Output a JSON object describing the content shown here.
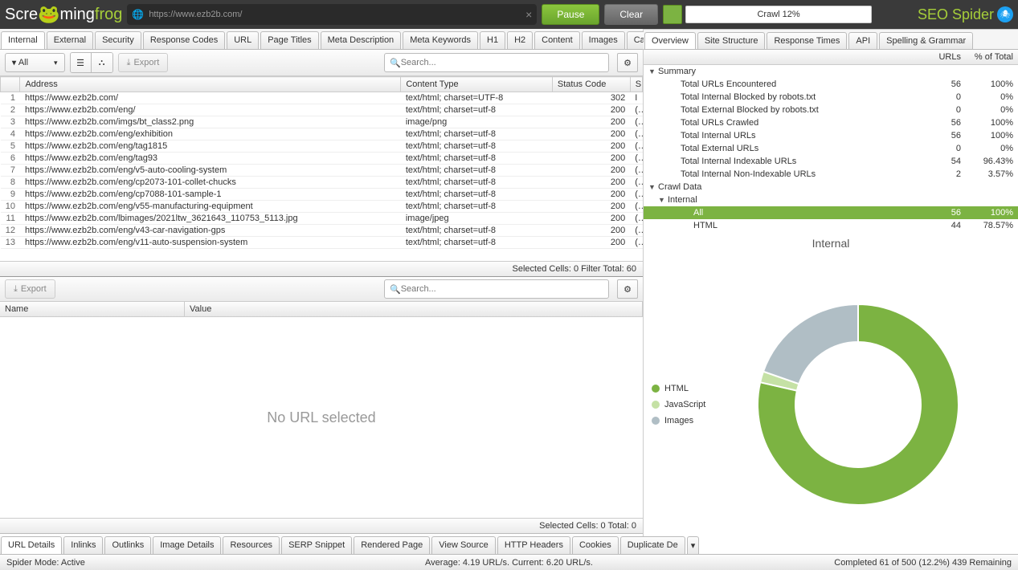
{
  "header": {
    "logo_plain1": "Scre",
    "logo_plain2": "ming",
    "logo_accent": "frog",
    "url": "https://www.ezb2b.com/",
    "pause": "Pause",
    "clear": "Clear",
    "progress_text": "Crawl 12%",
    "seo_spider": "SEO Spider"
  },
  "main_tabs": [
    "Internal",
    "External",
    "Security",
    "Response Codes",
    "URL",
    "Page Titles",
    "Meta Description",
    "Meta Keywords",
    "H1",
    "H2",
    "Content",
    "Images",
    "Canonicals"
  ],
  "toolbar": {
    "filter_all": "All",
    "export": "Export",
    "search_placeholder": "Search..."
  },
  "columns": {
    "address": "Address",
    "content_type": "Content Type",
    "status_code": "Status Code",
    "s": "S"
  },
  "rows": [
    {
      "n": 1,
      "address": "https://www.ezb2b.com/",
      "ct": "text/html; charset=UTF-8",
      "sc": "302",
      "s": "I"
    },
    {
      "n": 2,
      "address": "https://www.ezb2b.com/eng/",
      "ct": "text/html; charset=utf-8",
      "sc": "200",
      "s": "("
    },
    {
      "n": 3,
      "address": "https://www.ezb2b.com/imgs/bt_class2.png",
      "ct": "image/png",
      "sc": "200",
      "s": "("
    },
    {
      "n": 4,
      "address": "https://www.ezb2b.com/eng/exhibition",
      "ct": "text/html; charset=utf-8",
      "sc": "200",
      "s": "("
    },
    {
      "n": 5,
      "address": "https://www.ezb2b.com/eng/tag1815",
      "ct": "text/html; charset=utf-8",
      "sc": "200",
      "s": "("
    },
    {
      "n": 6,
      "address": "https://www.ezb2b.com/eng/tag93",
      "ct": "text/html; charset=utf-8",
      "sc": "200",
      "s": "("
    },
    {
      "n": 7,
      "address": "https://www.ezb2b.com/eng/v5-auto-cooling-system",
      "ct": "text/html; charset=utf-8",
      "sc": "200",
      "s": "("
    },
    {
      "n": 8,
      "address": "https://www.ezb2b.com/eng/cp2073-101-collet-chucks",
      "ct": "text/html; charset=utf-8",
      "sc": "200",
      "s": "("
    },
    {
      "n": 9,
      "address": "https://www.ezb2b.com/eng/cp7088-101-sample-1",
      "ct": "text/html; charset=utf-8",
      "sc": "200",
      "s": "("
    },
    {
      "n": 10,
      "address": "https://www.ezb2b.com/eng/v55-manufacturing-equipment",
      "ct": "text/html; charset=utf-8",
      "sc": "200",
      "s": "("
    },
    {
      "n": 11,
      "address": "https://www.ezb2b.com/lbimages/2021ltw_3621643_110753_5113.jpg",
      "ct": "image/jpeg",
      "sc": "200",
      "s": "("
    },
    {
      "n": 12,
      "address": "https://www.ezb2b.com/eng/v43-car-navigation-gps",
      "ct": "text/html; charset=utf-8",
      "sc": "200",
      "s": "("
    },
    {
      "n": 13,
      "address": "https://www.ezb2b.com/eng/v11-auto-suspension-system",
      "ct": "text/html; charset=utf-8",
      "sc": "200",
      "s": "("
    }
  ],
  "grid_footer": "Selected Cells: 0  Filter Total: 60",
  "lower": {
    "export": "Export",
    "name": "Name",
    "value": "Value",
    "no_url": "No URL selected",
    "footer": "Selected Cells: 0  Total: 0"
  },
  "bottom_tabs": [
    "URL Details",
    "Inlinks",
    "Outlinks",
    "Image Details",
    "Resources",
    "SERP Snippet",
    "Rendered Page",
    "View Source",
    "HTTP Headers",
    "Cookies",
    "Duplicate De"
  ],
  "right_tabs": [
    "Overview",
    "Site Structure",
    "Response Times",
    "API",
    "Spelling & Grammar"
  ],
  "right_header": {
    "urls": "URLs",
    "pct": "% of Total"
  },
  "tree": [
    {
      "type": "group",
      "label": "Summary",
      "indent": 0
    },
    {
      "label": "Total URLs Encountered",
      "c1": "56",
      "c2": "100%",
      "indent": 2
    },
    {
      "label": "Total Internal Blocked by robots.txt",
      "c1": "0",
      "c2": "0%",
      "indent": 2
    },
    {
      "label": "Total External Blocked by robots.txt",
      "c1": "0",
      "c2": "0%",
      "indent": 2
    },
    {
      "label": "Total URLs Crawled",
      "c1": "56",
      "c2": "100%",
      "indent": 2
    },
    {
      "label": "Total Internal URLs",
      "c1": "56",
      "c2": "100%",
      "indent": 2
    },
    {
      "label": "Total External URLs",
      "c1": "0",
      "c2": "0%",
      "indent": 2
    },
    {
      "label": "Total Internal Indexable URLs",
      "c1": "54",
      "c2": "96.43%",
      "indent": 2
    },
    {
      "label": "Total Internal Non-Indexable URLs",
      "c1": "2",
      "c2": "3.57%",
      "indent": 2
    },
    {
      "type": "group",
      "label": "Crawl Data",
      "indent": 0
    },
    {
      "type": "group",
      "label": "Internal",
      "indent": 1
    },
    {
      "label": "All",
      "c1": "56",
      "c2": "100%",
      "indent": 3,
      "sel": true
    },
    {
      "label": "HTML",
      "c1": "44",
      "c2": "78.57%",
      "indent": 3
    }
  ],
  "chart_title": "Internal",
  "legend": [
    {
      "label": "HTML",
      "color": "#7cb342"
    },
    {
      "label": "JavaScript",
      "color": "#c5e1a5"
    },
    {
      "label": "Images",
      "color": "#b0bec5"
    }
  ],
  "chart_data": {
    "type": "pie",
    "title": "Internal",
    "series": [
      {
        "name": "HTML",
        "value": 44,
        "color": "#7cb342"
      },
      {
        "name": "JavaScript",
        "value": 1,
        "color": "#c5e1a5"
      },
      {
        "name": "Images",
        "value": 11,
        "color": "#b0bec5"
      }
    ]
  },
  "status": {
    "left": "Spider Mode: Active",
    "mid": "Average: 4.19 URL/s. Current: 6.20 URL/s.",
    "right": "Completed 61 of 500 (12.2%) 439 Remaining"
  }
}
